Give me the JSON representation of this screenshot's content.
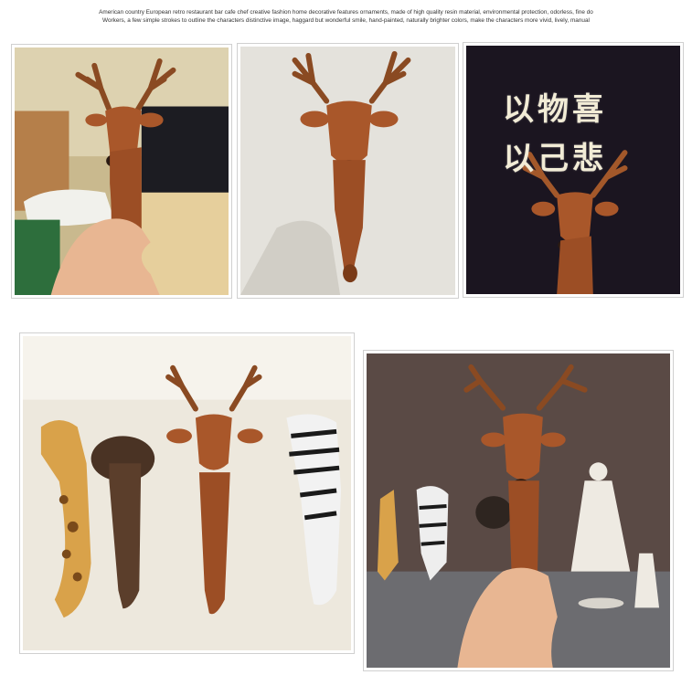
{
  "caption": {
    "line1": "American country European retro restaurant bar cafe chef creative fashion home decorative features ornaments, made of high quality resin material, environmental protection, odorless, fine do",
    "line2": "Workers, a few simple strokes to outline the characters distinctive image, haggard but wonderful smile, hand-painted, naturally brighter colors, make the characters more vivid, lively, manual"
  },
  "photos": {
    "photo3": {
      "text_line1": "以物喜",
      "text_line2": "以己悲"
    }
  },
  "colors": {
    "deer_fur": "#a9572a",
    "antler": "#7a3b18",
    "zebra_stripe": "#1a1a1a",
    "giraffe_fur": "#d9a24a"
  }
}
